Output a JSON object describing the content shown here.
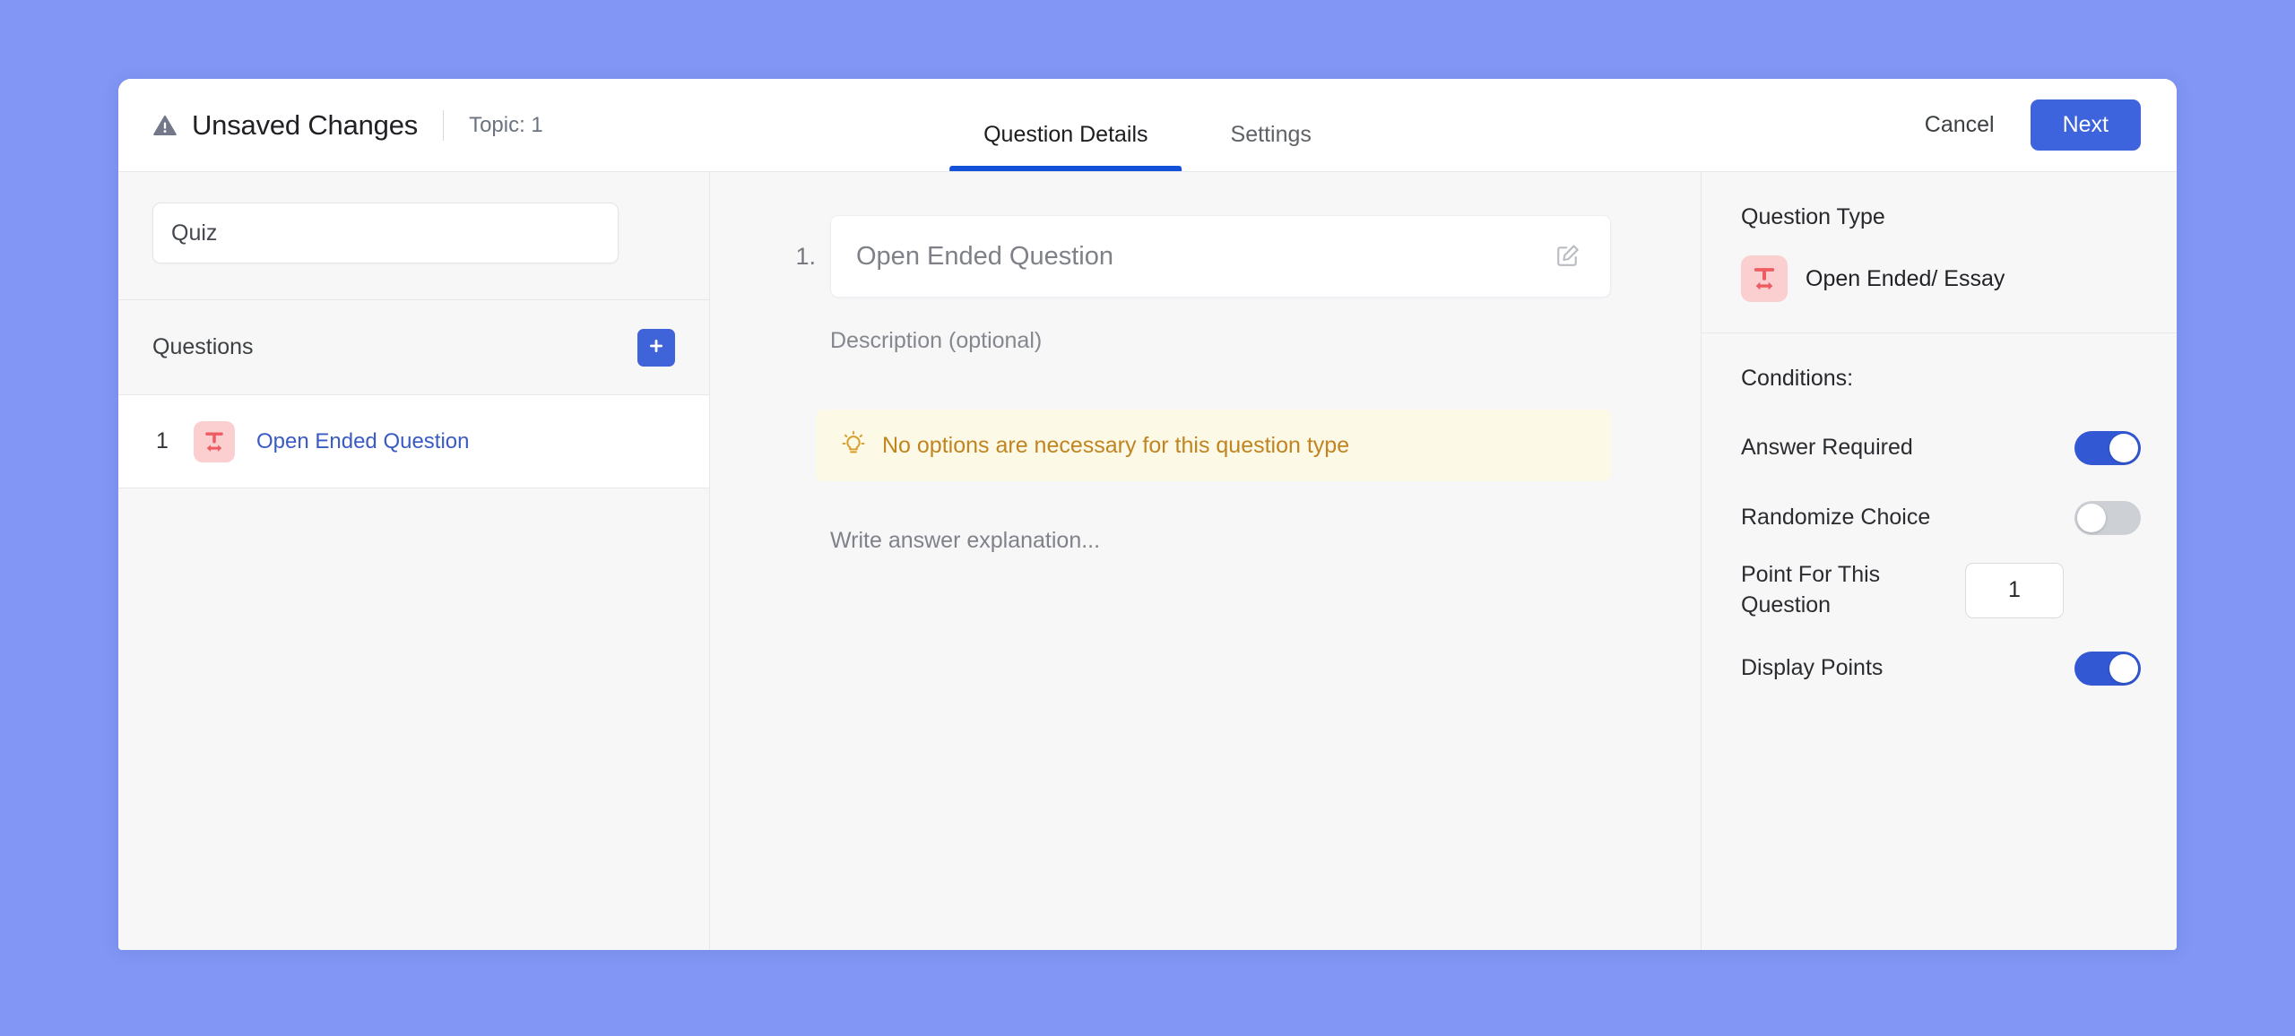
{
  "header": {
    "warning_icon": "warning-triangle-icon",
    "unsaved_title": "Unsaved Changes",
    "topic_label": "Topic: 1",
    "tabs": [
      {
        "label": "Question Details",
        "active": true
      },
      {
        "label": "Settings",
        "active": false
      }
    ],
    "cancel_label": "Cancel",
    "next_label": "Next",
    "accent_color": "#3d63dd",
    "active_tab_underline_color": "#1352d8"
  },
  "sidebar": {
    "quiz_name_value": "Quiz",
    "quiz_name_placeholder": "Quiz",
    "questions_label": "Questions",
    "add_icon": "plus-icon",
    "add_button_color": "#3f63d8",
    "questions": [
      {
        "index": "1",
        "title": "Open Ended Question",
        "type_icon": "open-ended-text-icon",
        "icon_bg": "#fbcfd0",
        "icon_color": "#ef5b62",
        "title_color": "#3b5bc4"
      }
    ]
  },
  "main": {
    "question_number": "1.",
    "question_placeholder": "Open Ended Question",
    "edit_icon": "edit-pencil-icon",
    "description_placeholder": "Description (optional)",
    "notice": {
      "icon": "lightbulb-icon",
      "text": "No options are necessary for this question type",
      "bg_color": "#fdf9e7",
      "text_color": "#c08420"
    },
    "explanation_placeholder": "Write answer explanation..."
  },
  "right_panel": {
    "question_type_heading": "Question Type",
    "question_type_value": "Open Ended/ Essay",
    "question_type_icon": "open-ended-text-icon",
    "conditions_heading": "Conditions:",
    "conditions": [
      {
        "label": "Answer Required",
        "control": "toggle",
        "state": "on"
      },
      {
        "label": "Randomize Choice",
        "control": "toggle",
        "state": "off"
      },
      {
        "label": "Point For This Question",
        "control": "input",
        "value": "1"
      },
      {
        "label": "Display Points",
        "control": "toggle",
        "state": "on"
      }
    ],
    "toggle_on_color": "#3258d4",
    "toggle_off_color": "#cdd0d5"
  },
  "page": {
    "background_color": "#8296f5"
  }
}
